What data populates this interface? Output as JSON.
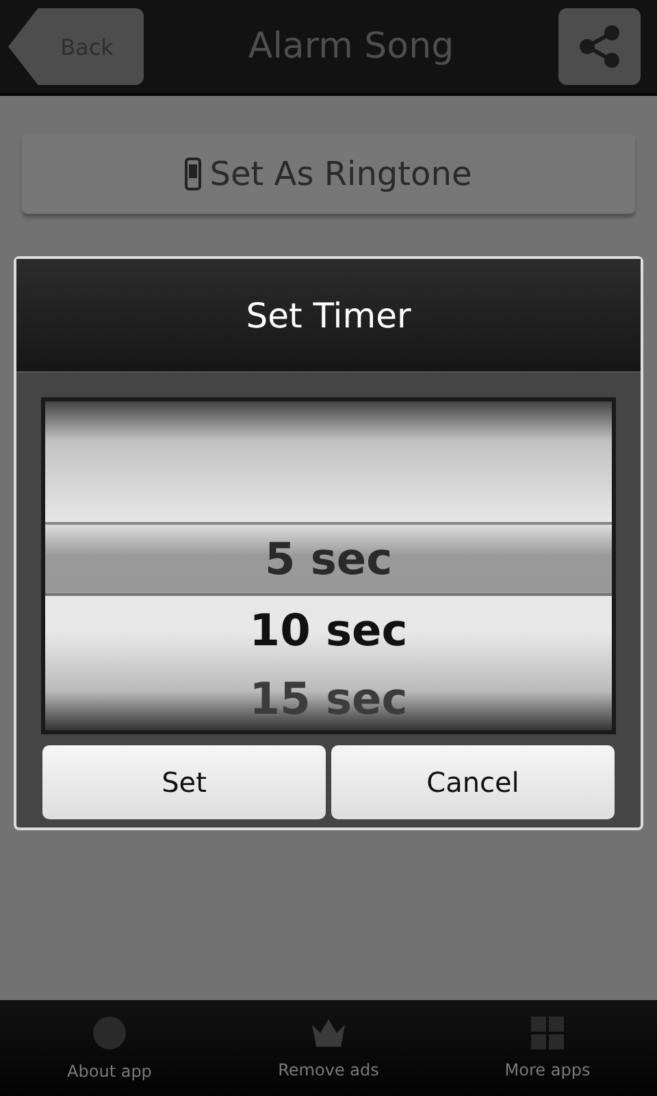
{
  "header": {
    "back": "Back",
    "title": "Alarm Song"
  },
  "ringtone_button": "Set As Ringtone",
  "dialog": {
    "title": "Set Timer",
    "options": [
      {
        "label": "5 sec",
        "selected": true
      },
      {
        "label": "10 sec",
        "selected": false
      },
      {
        "label": "15 sec",
        "selected": false
      }
    ],
    "buttons": [
      "Set",
      "Cancel"
    ]
  },
  "bottom_bar": [
    {
      "kind": "info",
      "label": "About app"
    },
    {
      "kind": "crown",
      "label": "Remove ads"
    },
    {
      "kind": "grid",
      "label": "More apps"
    }
  ]
}
